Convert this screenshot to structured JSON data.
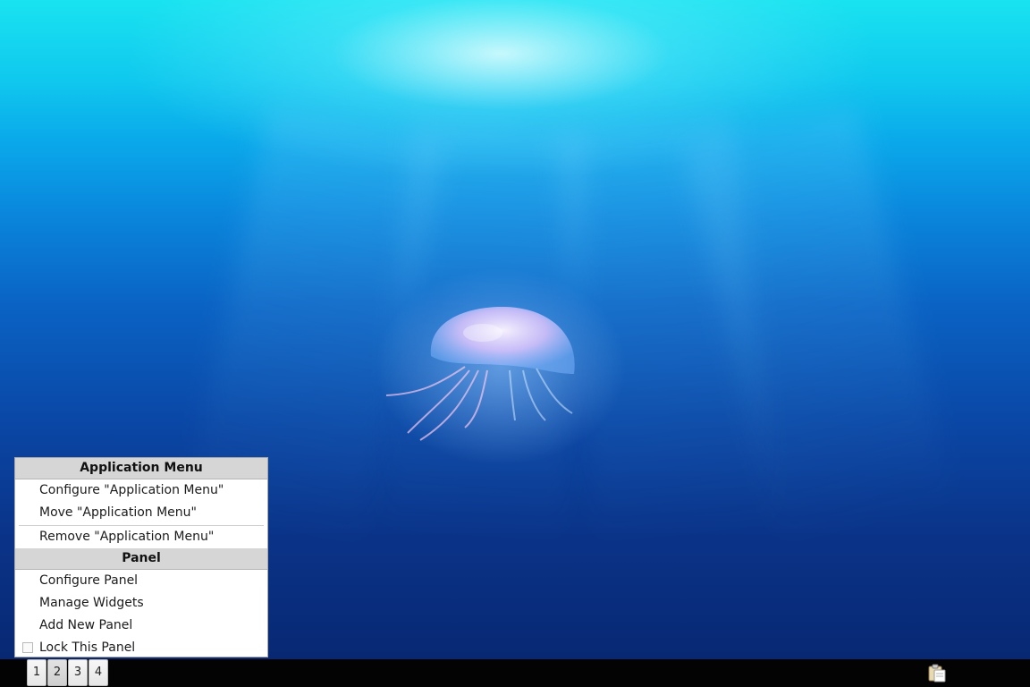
{
  "desktop": {
    "wallpaper": "jellyfish-underwater",
    "colors": {
      "surface": "#19e3f0",
      "deep": "#082873",
      "jelly": "#f2d6ff"
    }
  },
  "context_menu": {
    "app_section": {
      "header": "Application Menu",
      "configure_label": "Configure \"Application Menu\"",
      "move_label": "Move \"Application Menu\"",
      "remove_label": "Remove \"Application Menu\""
    },
    "panel_section": {
      "header": "Panel",
      "configure_label": "Configure Panel",
      "manage_label": "Manage Widgets",
      "add_label": "Add New Panel",
      "lock_label": "Lock This Panel",
      "lock_checked": false
    }
  },
  "taskbar": {
    "pager": {
      "desktops": [
        "1",
        "2",
        "3",
        "4"
      ],
      "active": "2"
    },
    "tray": {
      "clipboard_icon": "clipboard-icon"
    },
    "colors": {
      "background": "#030303"
    }
  }
}
